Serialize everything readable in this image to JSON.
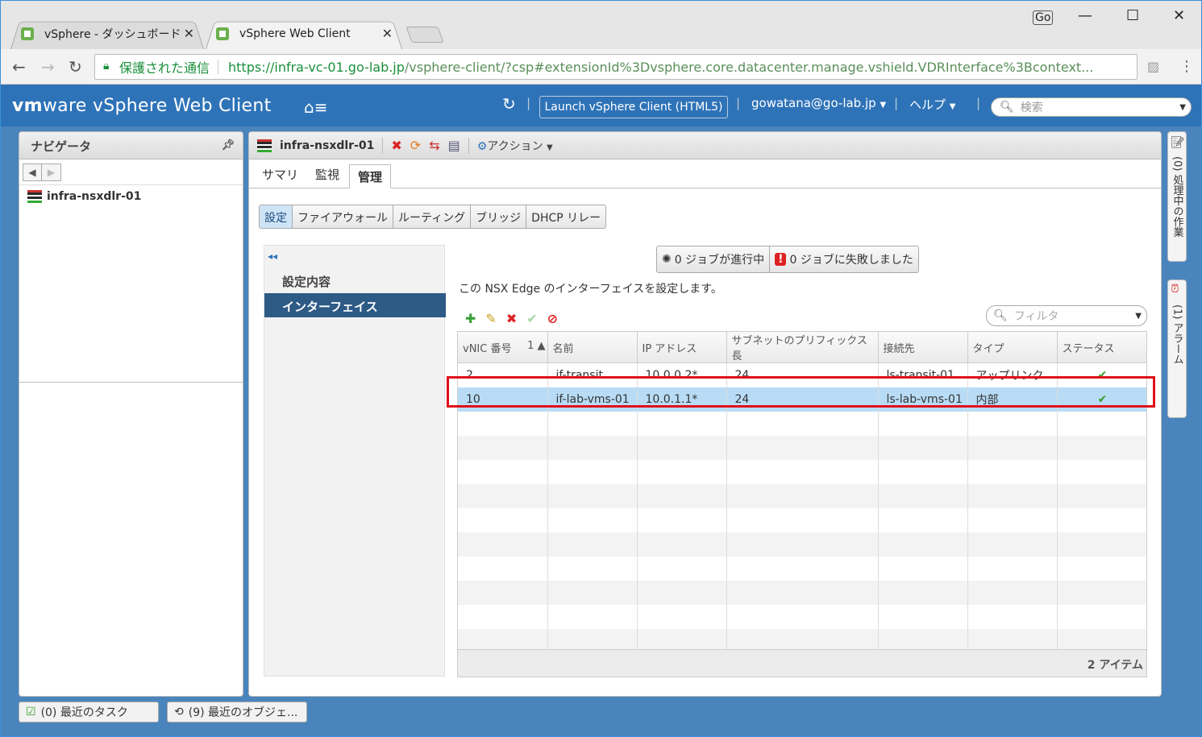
{
  "browser": {
    "tabs": [
      {
        "label": "vSphere - ダッシュボード"
      },
      {
        "label": "vSphere Web Client"
      }
    ],
    "profile_badge": "Go",
    "secure_label": "保護された通信",
    "url_host": "https://infra-vc-01.go-lab.jp",
    "url_path": "/vsphere-client/?csp#extensionId%3Dvsphere.core.datacenter.manage.vshield.VDRInterface%3Bcontext..."
  },
  "header": {
    "brand_vm": "vm",
    "brand_ware": "ware",
    "brand_product": " vSphere Web Client",
    "launch_label": "Launch vSphere Client (HTML5)",
    "user": "gowatana@go-lab.jp",
    "help": "ヘルプ",
    "search_placeholder": "検索"
  },
  "navigator": {
    "title": "ナビゲータ",
    "item": "infra-nsxdlr-01"
  },
  "main": {
    "object_title": "infra-nsxdlr-01",
    "actions_label": "アクション",
    "tabs": [
      {
        "label": "サマリ"
      },
      {
        "label": "監視"
      },
      {
        "label": "管理"
      }
    ],
    "segments": [
      {
        "label": "設定"
      },
      {
        "label": "ファイアウォール"
      },
      {
        "label": "ルーティング"
      },
      {
        "label": "ブリッジ"
      },
      {
        "label": "DHCP リレー"
      }
    ],
    "left_nav": [
      {
        "label": "設定内容"
      },
      {
        "label": "インターフェイス"
      }
    ],
    "jobs_running": "0 ジョブが進行中",
    "jobs_failed": "0 ジョブに失敗しました",
    "description": "この NSX Edge のインターフェイスを設定します。",
    "filter_placeholder": "フィルタ",
    "columns": [
      "vNIC 番号",
      "名前",
      "IP アドレス",
      "サブネットのプリフィックス長",
      "接続先",
      "タイプ",
      "ステータス"
    ],
    "sort_indicator": "1 ▲",
    "rows": [
      {
        "vnic": "2",
        "name": "if-transit",
        "ip": "10.0.0.2*",
        "prefix": "24",
        "connected": "ls-transit-01",
        "type": "アップリンク"
      },
      {
        "vnic": "10",
        "name": "if-lab-vms-01",
        "ip": "10.0.1.1*",
        "prefix": "24",
        "connected": "ls-lab-vms-01",
        "type": "内部"
      }
    ],
    "item_count": "2 アイテム"
  },
  "right_sidebar": {
    "tasks": "(0) 処理中の作業",
    "alarms": "(1) アラーム"
  },
  "bottom": {
    "recent_tasks": "(0)  最近のタスク",
    "recent_objects": "(9) 最近のオブジェ..."
  }
}
